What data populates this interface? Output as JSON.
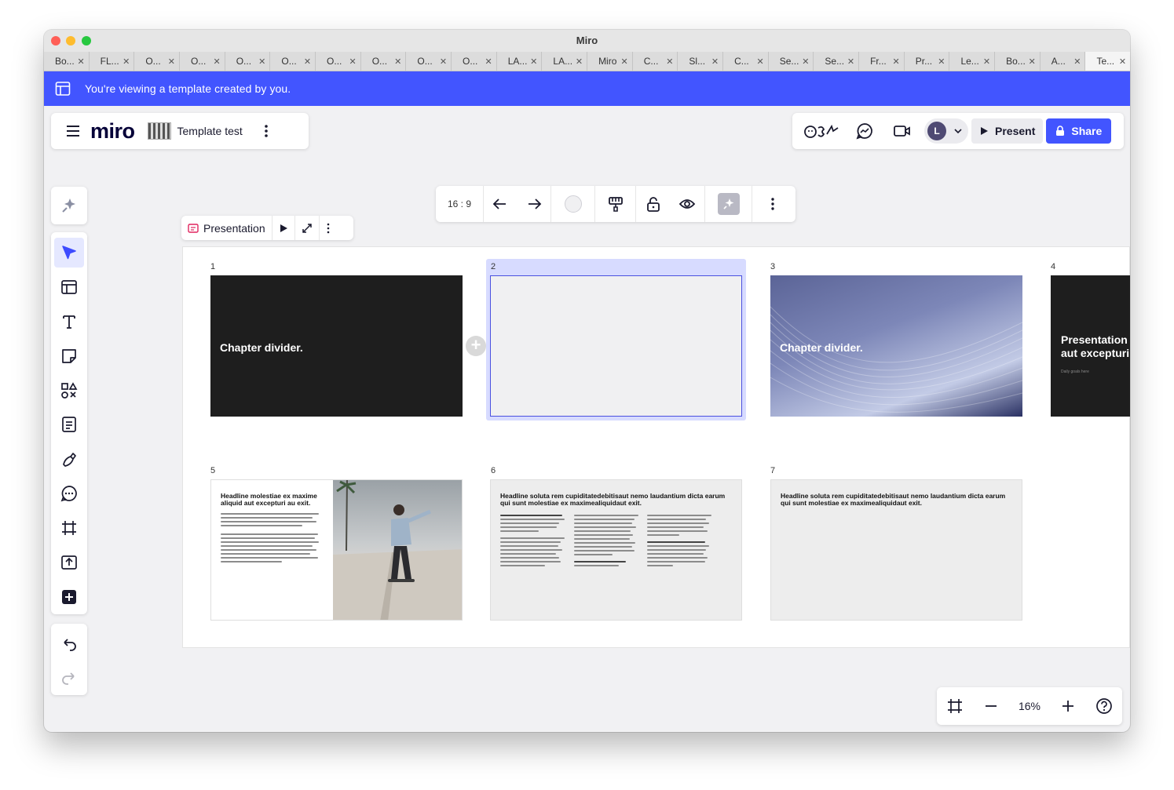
{
  "window": {
    "title": "Miro"
  },
  "tabs": [
    {
      "label": "Bo..."
    },
    {
      "label": "FL..."
    },
    {
      "label": "O..."
    },
    {
      "label": "O..."
    },
    {
      "label": "O..."
    },
    {
      "label": "O..."
    },
    {
      "label": "O..."
    },
    {
      "label": "O..."
    },
    {
      "label": "O..."
    },
    {
      "label": "O..."
    },
    {
      "label": "LA..."
    },
    {
      "label": "LA..."
    },
    {
      "label": "Miro"
    },
    {
      "label": "C..."
    },
    {
      "label": "Sl..."
    },
    {
      "label": "C..."
    },
    {
      "label": "Se..."
    },
    {
      "label": "Se..."
    },
    {
      "label": "Fr..."
    },
    {
      "label": "Pr..."
    },
    {
      "label": "Le..."
    },
    {
      "label": "Bo..."
    },
    {
      "label": "A..."
    },
    {
      "label": "Te...",
      "active": true
    }
  ],
  "banner": {
    "text": "You're viewing a template created by you."
  },
  "header": {
    "logo": "miro",
    "board_name": "Template test",
    "avatar_initial": "L",
    "present_label": "Present",
    "share_label": "Share"
  },
  "context_toolbar": {
    "ratio": "16 : 9"
  },
  "presentation_bar": {
    "label": "Presentation"
  },
  "slides": [
    {
      "number": "1",
      "title": "Chapter divider."
    },
    {
      "number": "2"
    },
    {
      "number": "3",
      "title": "Chapter divider."
    },
    {
      "number": "4",
      "title_line1": "Presentation",
      "title_line2": "aut excepturi",
      "subtitle": "Daily goals here"
    },
    {
      "number": "5",
      "headline": "Headline molestiae ex maxime aliquid aut excepturi au exit."
    },
    {
      "number": "6",
      "headline": "Headline soluta rem cupiditatedebitisaut nemo laudantium dicta earum qui sunt molestiae ex maximealiquidaut exit."
    },
    {
      "number": "7",
      "headline": "Headline soluta rem cupiditatedebitisaut nemo laudantium dicta earum qui sunt molestiae ex maximealiquidaut exit."
    }
  ],
  "zoom": {
    "level": "16%"
  },
  "colors": {
    "accent": "#4255ff",
    "dark_slide": "#1e1e1e"
  }
}
